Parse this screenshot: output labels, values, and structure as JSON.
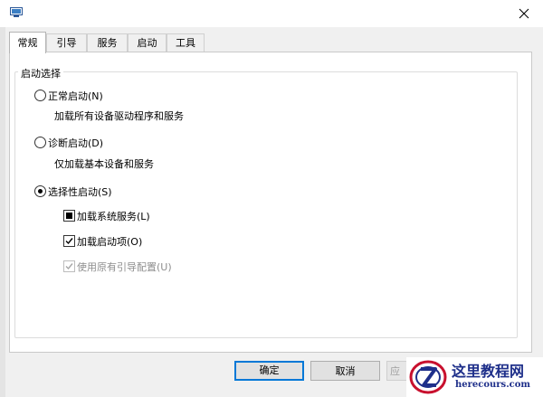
{
  "window": {
    "icon": "system-config-icon",
    "close_icon": "close-icon"
  },
  "tabs": [
    {
      "label": "常规",
      "active": true
    },
    {
      "label": "引导",
      "active": false
    },
    {
      "label": "服务",
      "active": false
    },
    {
      "label": "启动",
      "active": false
    },
    {
      "label": "工具",
      "active": false
    }
  ],
  "startup_group": {
    "legend": "启动选择",
    "normal": {
      "label": "正常启动(N)",
      "description": "加载所有设备驱动程序和服务",
      "selected": false
    },
    "diagnostic": {
      "label": "诊断启动(D)",
      "description": "仅加载基本设备和服务",
      "selected": false
    },
    "selective": {
      "label": "选择性启动(S)",
      "selected": true,
      "options": [
        {
          "label": "加载系统服务(L)",
          "state": "indeterminate",
          "enabled": true
        },
        {
          "label": "加载启动项(O)",
          "state": "checked",
          "enabled": true
        },
        {
          "label": "使用原有引导配置(U)",
          "state": "checked",
          "enabled": false
        }
      ]
    }
  },
  "buttons": {
    "ok": "确定",
    "cancel": "取消",
    "apply": "应"
  },
  "watermark": {
    "title": "这里教程网",
    "url": "herecours.com"
  }
}
